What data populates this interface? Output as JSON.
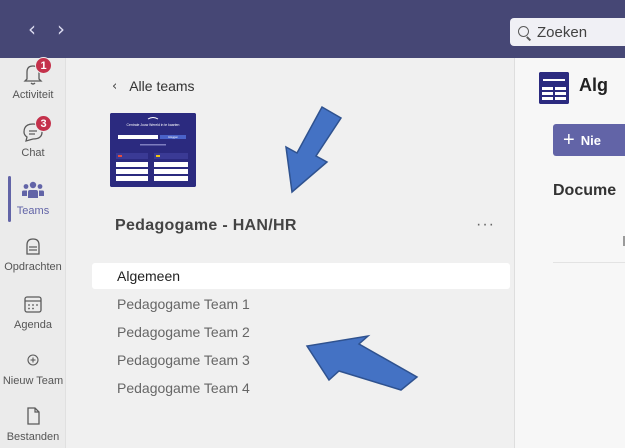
{
  "topbar": {
    "back_icon": "‹",
    "forward_icon": "›",
    "search_placeholder": "Zoeken",
    "color": "#464775"
  },
  "rail": {
    "items": [
      {
        "label": "Activiteit",
        "icon": "bell-icon",
        "badge": "1"
      },
      {
        "label": "Chat",
        "icon": "chat-icon",
        "badge": "3"
      },
      {
        "label": "Teams",
        "icon": "teams-icon",
        "active": true
      },
      {
        "label": "Opdrachten",
        "icon": "assignments-icon"
      },
      {
        "label": "Agenda",
        "icon": "calendar-icon"
      },
      {
        "label": "Nieuw Team",
        "icon": "add-team-icon"
      },
      {
        "label": "Bestanden",
        "icon": "file-icon"
      }
    ]
  },
  "panel": {
    "back_label": "Alle teams",
    "team_name": "Pedagogame - HAN/HR",
    "more_label": "···",
    "thumb_texts": {
      "title": "Centrale Jouw Wereld in te kaarten",
      "button": "Inloggen"
    },
    "channels": [
      {
        "label": "Algemeen",
        "selected": true
      },
      {
        "label": "Pedagogame Team 1"
      },
      {
        "label": "Pedagogame Team 2"
      },
      {
        "label": "Pedagogame Team 3"
      },
      {
        "label": "Pedagogame Team 4"
      }
    ]
  },
  "right": {
    "channel_title": "Alg",
    "new_button": "Nie",
    "new_icon": "+",
    "tab_label": "Docume"
  },
  "colors": {
    "accent": "#6264a7",
    "badge": "#c4314b",
    "arrow": "#4472c4"
  }
}
